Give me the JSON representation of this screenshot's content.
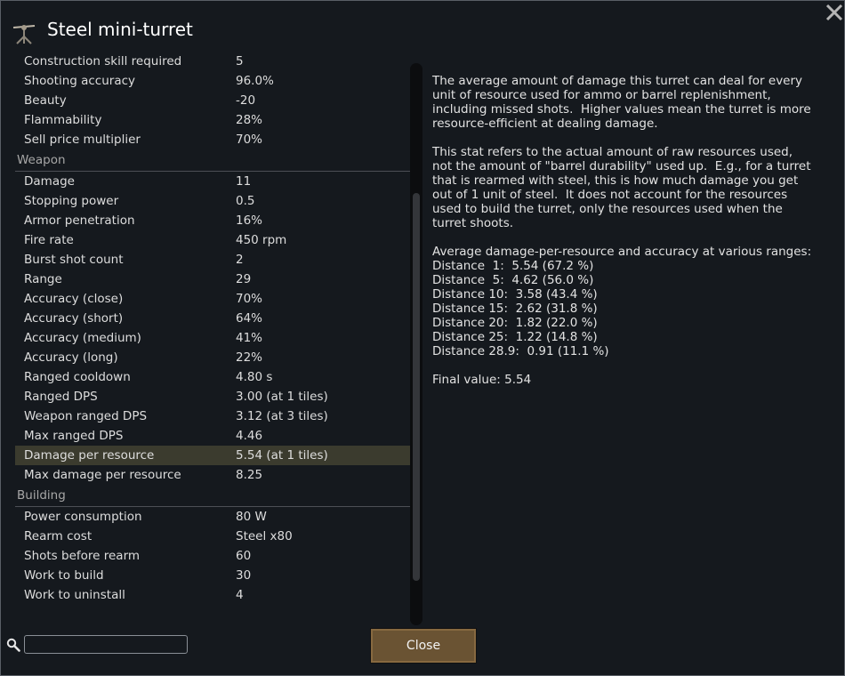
{
  "window": {
    "title": "Steel mini-turret",
    "close_icon": "close-icon",
    "title_icon": "turret-icon"
  },
  "stats": {
    "partial_row": {
      "label": "Construction skill required",
      "value": "5"
    },
    "general": [
      {
        "label": "Shooting accuracy",
        "value": "96.0%"
      },
      {
        "label": "Beauty",
        "value": "-20"
      },
      {
        "label": "Flammability",
        "value": "28%"
      },
      {
        "label": "Sell price multiplier",
        "value": "70%"
      }
    ],
    "weapon_header": "Weapon",
    "weapon": [
      {
        "label": "Damage",
        "value": "11"
      },
      {
        "label": "Stopping power",
        "value": "0.5"
      },
      {
        "label": "Armor penetration",
        "value": "16%"
      },
      {
        "label": "Fire rate",
        "value": "450 rpm"
      },
      {
        "label": "Burst shot count",
        "value": "2"
      },
      {
        "label": "Range",
        "value": "29"
      },
      {
        "label": "Accuracy (close)",
        "value": "70%"
      },
      {
        "label": "Accuracy (short)",
        "value": "64%"
      },
      {
        "label": "Accuracy (medium)",
        "value": "41%"
      },
      {
        "label": "Accuracy (long)",
        "value": "22%"
      },
      {
        "label": "Ranged cooldown",
        "value": "4.80 s"
      },
      {
        "label": "Ranged DPS",
        "value": "3.00 (at 1 tiles)"
      },
      {
        "label": "Weapon ranged DPS",
        "value": "3.12 (at 3 tiles)"
      },
      {
        "label": "Max ranged DPS",
        "value": "4.46"
      },
      {
        "label": "Damage per resource",
        "value": "5.54 (at 1 tiles)"
      },
      {
        "label": "Max damage per resource",
        "value": "8.25"
      }
    ],
    "building_header": "Building",
    "building": [
      {
        "label": "Power consumption",
        "value": "80 W"
      },
      {
        "label": "Rearm cost",
        "value": "Steel x80"
      },
      {
        "label": "Shots before rearm",
        "value": "60"
      },
      {
        "label": "Work to build",
        "value": "30"
      },
      {
        "label": "Work to uninstall",
        "value": "4"
      }
    ]
  },
  "scroll_position": 0.23,
  "description": "The average amount of damage this turret can deal for every unit of resource used for ammo or barrel replenishment, including missed shots.  Higher values mean the turret is more resource-efficient at dealing damage.\n\nThis stat refers to the actual amount of raw resources used, not the amount of \"barrel durability\" used up.  E.g., for a turret that is rearmed with steel, this is how much damage you get out of 1 unit of steel.  It does not account for the resources used to build the turret, only the resources used when the turret shoots.\n\nAverage damage-per-resource and accuracy at various ranges:\nDistance  1:  5.54 (67.2 %)\nDistance  5:  4.62 (56.0 %)\nDistance 10:  3.58 (43.4 %)\nDistance 15:  2.62 (31.8 %)\nDistance 20:  1.82 (22.0 %)\nDistance 25:  1.22 (14.8 %)\nDistance 28.9:  0.91 (11.1 %)\n\nFinal value: 5.54",
  "search": {
    "value": "",
    "placeholder": "",
    "icon": "search-icon"
  },
  "close_button": {
    "label": "Close"
  },
  "colors": {
    "highlight_row": "#3b3b2e",
    "close_button": "#6a5333",
    "background": "#15191e"
  }
}
